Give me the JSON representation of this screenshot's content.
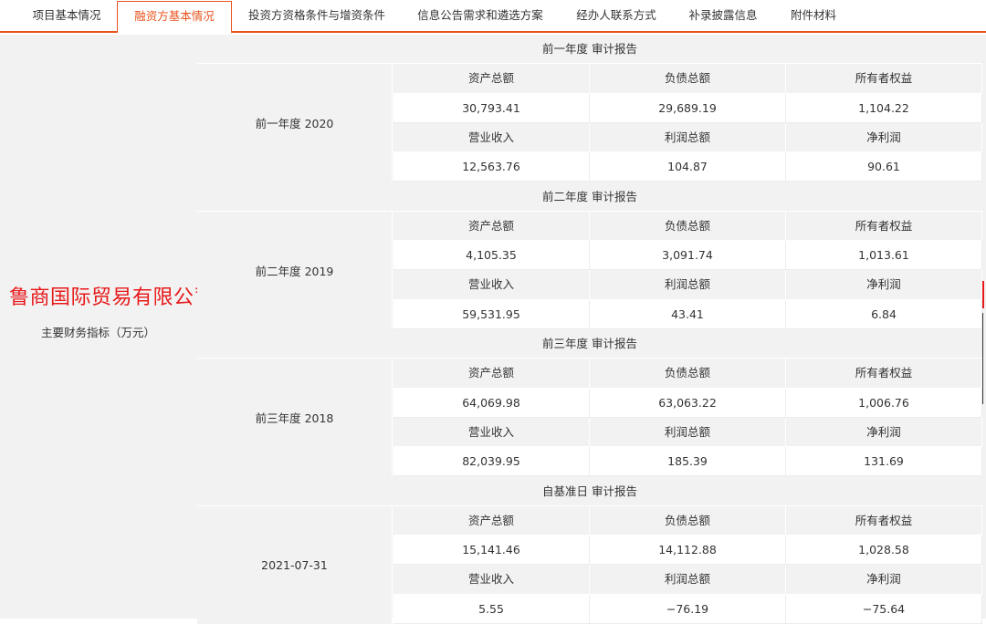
{
  "tabs": [
    {
      "label": "项目基本情况"
    },
    {
      "label": "融资方基本情况"
    },
    {
      "label": "投资方资格条件与增资条件"
    },
    {
      "label": "信息公告需求和遴选方案"
    },
    {
      "label": "经办人联系方式"
    },
    {
      "label": "补录披露信息"
    },
    {
      "label": "附件材料"
    }
  ],
  "active_tab": "融资方基本情况",
  "company_name": "鲁商国际贸易有限公司",
  "metric_label": "主要财务指标（万元）",
  "colors": {
    "accent": "#e8541e",
    "company_red": "#e8191a",
    "panel": "#f2f2f2"
  },
  "blocks": [
    {
      "title": "前一年度 审计报告",
      "period": "前一年度 2020",
      "head1": [
        "资产总额",
        "负债总额",
        "所有者权益"
      ],
      "vals1": [
        "30,793.41",
        "29,689.19",
        "1,104.22"
      ],
      "head2": [
        "营业收入",
        "利润总额",
        "净利润"
      ],
      "vals2": [
        "12,563.76",
        "104.87",
        "90.61"
      ]
    },
    {
      "title": "前二年度 审计报告",
      "period": "前二年度 2019",
      "head1": [
        "资产总额",
        "负债总额",
        "所有者权益"
      ],
      "vals1": [
        "4,105.35",
        "3,091.74",
        "1,013.61"
      ],
      "head2": [
        "营业收入",
        "利润总额",
        "净利润"
      ],
      "vals2": [
        "59,531.95",
        "43.41",
        "6.84"
      ]
    },
    {
      "title": "前三年度 审计报告",
      "period": "前三年度 2018",
      "head1": [
        "资产总额",
        "负债总额",
        "所有者权益"
      ],
      "vals1": [
        "64,069.98",
        "63,063.22",
        "1,006.76"
      ],
      "head2": [
        "营业收入",
        "利润总额",
        "净利润"
      ],
      "vals2": [
        "82,039.95",
        "185.39",
        "131.69"
      ]
    },
    {
      "title": "自基准日 审计报告",
      "period": "2021-07-31",
      "head1": [
        "资产总额",
        "负债总额",
        "所有者权益"
      ],
      "vals1": [
        "15,141.46",
        "14,112.88",
        "1,028.58"
      ],
      "head2": [
        "营业收入",
        "利润总额",
        "净利润"
      ],
      "vals2": [
        "5.55",
        "−76.19",
        "−75.64"
      ]
    }
  ]
}
